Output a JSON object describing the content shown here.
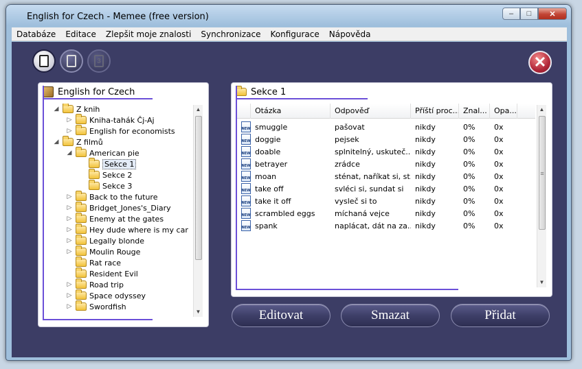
{
  "window": {
    "title": "English for Czech - Memee (free version)"
  },
  "window_buttons": {
    "minimize": "–",
    "maximize": "□",
    "close": "✕"
  },
  "menu": [
    "Databáze",
    "Editace",
    "Zlepšit moje znalosti",
    "Synchronizace",
    "Konfigurace",
    "Nápověda"
  ],
  "toolbar": {
    "disabled_icon_text": "3"
  },
  "close_app_glyph": "✕",
  "left_panel": {
    "title": "English for Czech"
  },
  "tree": [
    {
      "label": "Z knih",
      "level": 0,
      "expander": "◢",
      "folder": true
    },
    {
      "label": "Kniha-tahák Čj-Aj",
      "level": 1,
      "expander": "▷",
      "folder": true
    },
    {
      "label": "English for economists",
      "level": 1,
      "expander": "▷",
      "folder": true
    },
    {
      "label": "Z filmů",
      "level": 0,
      "expander": "◢",
      "folder": true
    },
    {
      "label": "American pie",
      "level": 1,
      "expander": "◢",
      "folder": true
    },
    {
      "label": "Sekce 1",
      "level": 2,
      "expander": "",
      "folder": true,
      "selected": true
    },
    {
      "label": "Sekce 2",
      "level": 2,
      "expander": "",
      "folder": true
    },
    {
      "label": "Sekce 3",
      "level": 2,
      "expander": "",
      "folder": true
    },
    {
      "label": "Back to the future",
      "level": 1,
      "expander": "▷",
      "folder": true
    },
    {
      "label": "Bridget_Jones's_Diary",
      "level": 1,
      "expander": "▷",
      "folder": true
    },
    {
      "label": "Enemy at the gates",
      "level": 1,
      "expander": "▷",
      "folder": true
    },
    {
      "label": "Hey dude where is my car",
      "level": 1,
      "expander": "▷",
      "folder": true
    },
    {
      "label": "Legally blonde",
      "level": 1,
      "expander": "▷",
      "folder": true
    },
    {
      "label": "Moulin Rouge",
      "level": 1,
      "expander": "▷",
      "folder": true
    },
    {
      "label": "Rat race",
      "level": 1,
      "expander": "",
      "folder": true
    },
    {
      "label": "Resident Evil",
      "level": 1,
      "expander": "",
      "folder": true
    },
    {
      "label": "Road trip",
      "level": 1,
      "expander": "▷",
      "folder": true
    },
    {
      "label": "Space odyssey",
      "level": 1,
      "expander": "▷",
      "folder": true
    },
    {
      "label": "Swordfish",
      "level": 1,
      "expander": "▷",
      "folder": true
    }
  ],
  "right_panel": {
    "title": "Sekce 1"
  },
  "grid": {
    "columns": [
      "Otázka",
      "Odpověď",
      "Příští proc...",
      "Znal...",
      "Opa..."
    ],
    "row_icon_text": "NEW",
    "rows": [
      [
        "smuggle",
        "pašovat",
        "nikdy",
        "0%",
        "0x"
      ],
      [
        "doggie",
        "pejsek",
        "nikdy",
        "0%",
        "0x"
      ],
      [
        "doable",
        "splnitelný, uskuteč...",
        "nikdy",
        "0%",
        "0x"
      ],
      [
        "betrayer",
        "zrádce",
        "nikdy",
        "0%",
        "0x"
      ],
      [
        "moan",
        "sténat, naříkat si, st...",
        "nikdy",
        "0%",
        "0x"
      ],
      [
        "take off",
        "svléci si, sundat si",
        "nikdy",
        "0%",
        "0x"
      ],
      [
        "take it off",
        "vysleč si to",
        "nikdy",
        "0%",
        "0x"
      ],
      [
        "scrambled eggs",
        "míchaná vejce",
        "nikdy",
        "0%",
        "0x"
      ],
      [
        "spank",
        "naplácat, dát na za...",
        "nikdy",
        "0%",
        "0x"
      ]
    ]
  },
  "scroll": {
    "up": "▲",
    "down": "▼",
    "grip": "≡"
  },
  "buttons": {
    "edit": "Editovat",
    "delete": "Smazat",
    "add": "Přidat"
  }
}
